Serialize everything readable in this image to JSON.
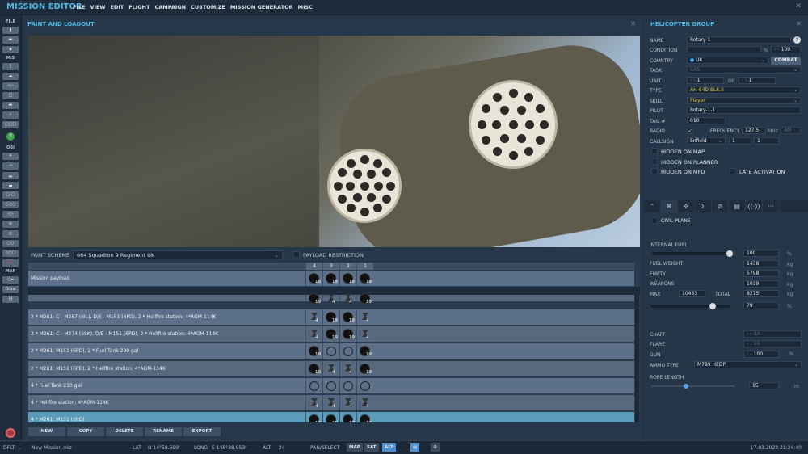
{
  "app": {
    "title": "MISSION EDITOR",
    "menu": [
      "FILE",
      "VIEW",
      "EDIT",
      "FLIGHT",
      "CAMPAIGN",
      "CUSTOMIZE",
      "MISSION GENERATOR",
      "MISC"
    ]
  },
  "toolbar": {
    "file_label": "FILE",
    "mis_label": "MIS",
    "obj_label": "OBJ",
    "map_label": "MAP",
    "draw_label": "Draw"
  },
  "paint": {
    "title": "PAINT AND LOADOUT",
    "paint_scheme_label": "PAINT SCHEME",
    "paint_scheme_value": "664 Squadron 9 Regiment UK",
    "payload_restriction_label": "PAYLOAD RESTRICTION",
    "stations": [
      "4",
      "3",
      "2",
      "1"
    ],
    "mission_payload": {
      "name": "Mission payload",
      "counts": [
        "19",
        "19",
        "19",
        "19"
      ],
      "kinds": [
        "rk",
        "rk",
        "rk",
        "rk"
      ]
    },
    "rows": [
      {
        "name": "",
        "counts": [
          "19",
          "4",
          "4",
          "19"
        ],
        "kinds": [
          "rk",
          "hf",
          "hf",
          "rk"
        ]
      },
      {
        "name": "2 * M261: C - M257 (6IL), D/E - M151 (6PD), 2 * Hellfire station: 4*AGM-114K",
        "counts": [
          "4",
          "19",
          "19",
          "4"
        ],
        "kinds": [
          "hf",
          "rk",
          "rk",
          "hf"
        ]
      },
      {
        "name": "2 * M261: C - M274 (6SK), D/E - M151 (6PD), 2 * Hellfire station: 4*AGM-114K",
        "counts": [
          "4",
          "19",
          "19",
          "4"
        ],
        "kinds": [
          "hf",
          "rk",
          "rk",
          "hf"
        ]
      },
      {
        "name": "2 * M261: M151 (6PD), 2 * Fuel Tank 230 gal",
        "counts": [
          "19",
          "",
          "",
          "19"
        ],
        "kinds": [
          "rk",
          "ft",
          "ft",
          "rk"
        ]
      },
      {
        "name": "2 * M261: M151 (6PD), 2 * Hellfire station: 4*AGM-114K",
        "counts": [
          "19",
          "4",
          "4",
          "19"
        ],
        "kinds": [
          "rk",
          "hf",
          "hf",
          "rk"
        ]
      },
      {
        "name": "4 * Fuel Tank 230 gal",
        "counts": [
          "",
          "",
          "",
          ""
        ],
        "kinds": [
          "ft",
          "ft",
          "ft",
          "ft"
        ]
      },
      {
        "name": "4 * Hellfire station: 4*AGM-114K",
        "counts": [
          "4",
          "4",
          "4",
          "4"
        ],
        "kinds": [
          "hf",
          "hf",
          "hf",
          "hf"
        ]
      },
      {
        "name": "4 * M261: M151 (6PD)",
        "counts": [
          "19",
          "19",
          "19",
          "19"
        ],
        "kinds": [
          "rk",
          "rk",
          "rk",
          "rk"
        ],
        "selected": true
      }
    ],
    "buttons": [
      "NEW",
      "COPY",
      "DELETE",
      "RENAME",
      "EXPORT"
    ]
  },
  "group": {
    "title": "HELICOPTER GROUP",
    "name_label": "NAME",
    "name": "Rotary-1",
    "help": "?",
    "condition_label": "CONDITION",
    "condition_unit": "%",
    "condition": "100",
    "country_label": "COUNTRY",
    "country": "UK",
    "combat": "COMBAT",
    "task_label": "TASK",
    "task": "CAS",
    "unit_label": "UNIT",
    "unit": "1",
    "of_label": "OF",
    "unit_of": "1",
    "type_label": "TYPE",
    "type": "AH-64D BLK.II",
    "skill_label": "SKILL",
    "skill": "Player",
    "pilot_label": "PILOT",
    "pilot": "Rotary-1-1",
    "tail_label": "TAIL #",
    "tail": "010",
    "radio_label": "RADIO",
    "frequency_label": "FREQUENCY",
    "frequency": "127.5",
    "mhz": "MHz",
    "modulation": "AM",
    "callsign_label": "CALLSIGN",
    "callsign": "Enfield",
    "callsign_n1": "1",
    "callsign_n2": "1",
    "hidden_map": "HIDDEN ON MAP",
    "hidden_planner": "HIDDEN ON PLANNER",
    "hidden_mfd": "HIDDEN ON MFD",
    "late_activation": "LATE ACTIVATION"
  },
  "loadout": {
    "civil_plane": "CIVIL PLANE",
    "internal_fuel_label": "INTERNAL FUEL",
    "internal_fuel": "100",
    "fuel_pct": 100,
    "pct": "%",
    "kg": "kg",
    "fuel_weight_label": "FUEL WEIGHT",
    "fuel_weight": "1438",
    "empty_label": "EMPTY",
    "empty": "5798",
    "weapons_label": "WEAPONS",
    "weapons": "1039",
    "max_label": "MAX",
    "max": "10433",
    "total_label": "TOTAL",
    "total": "8275",
    "load_pct": "79",
    "chaff_label": "CHAFF",
    "chaff": "30",
    "flare_label": "FLARE",
    "flare": "60",
    "gun_label": "GUN",
    "gun": "100",
    "ammo_label": "AMMO TYPE",
    "ammo": "M789 HEDP",
    "rope_label": "ROPE LENGTH",
    "rope": "15",
    "rope_unit": "m"
  },
  "status": {
    "profile": "DFLT",
    "file": "New Mission.miz",
    "lat_label": "LAT",
    "lat": "N 14°58.599'",
    "long_label": "LONG",
    "long": "E 145°38.953'",
    "alt_label": "ALT",
    "alt": "24",
    "pan_select": "PAN/SELECT",
    "map": "MAP",
    "sat": "SAT",
    "alt_btn": "ALT",
    "datetime": "17.03.2022 21:24:40"
  }
}
